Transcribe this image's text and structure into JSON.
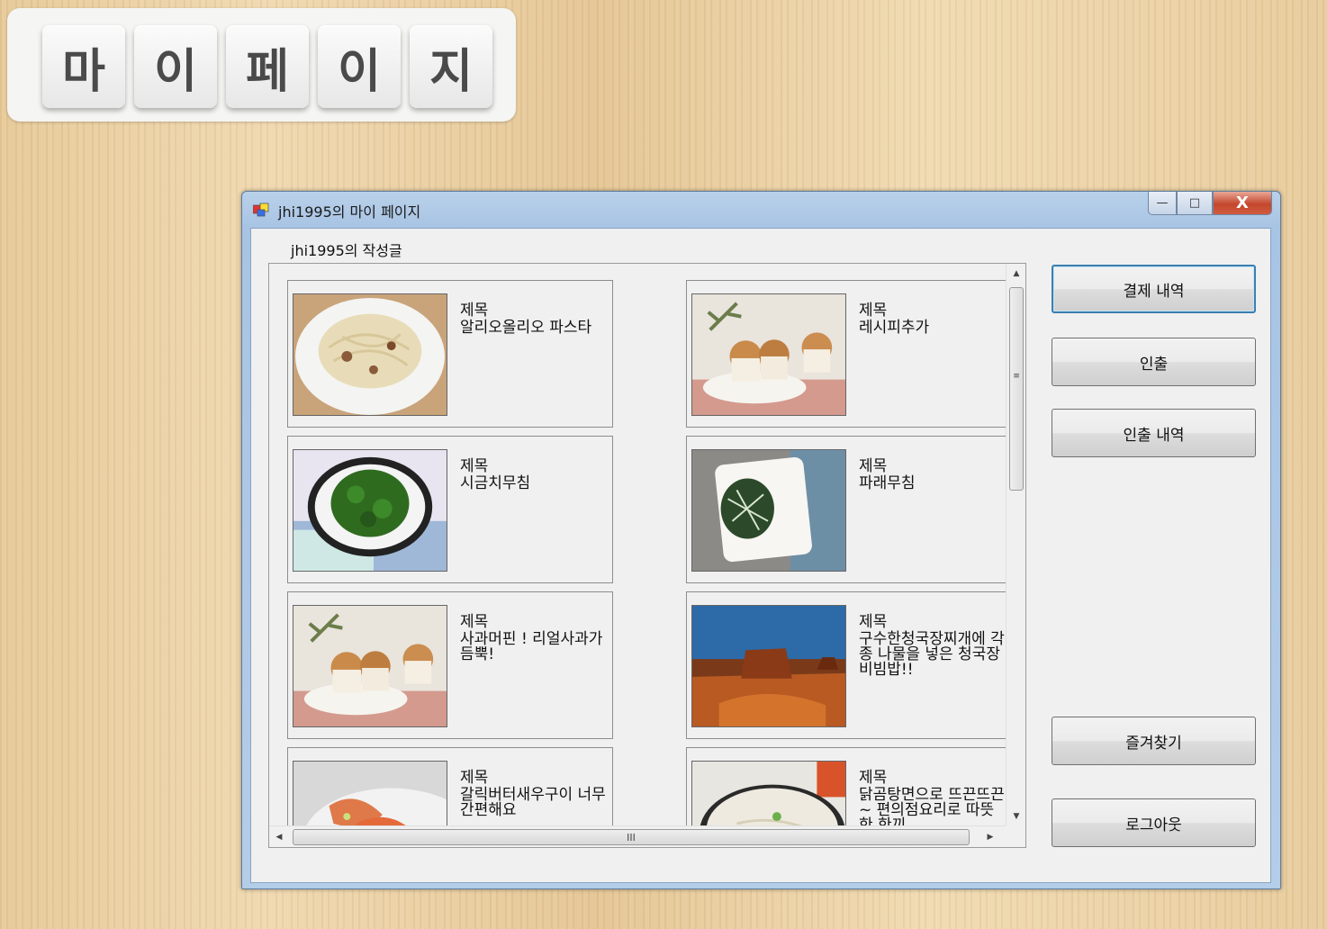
{
  "banner": {
    "chars": [
      "마",
      "이",
      "페",
      "이",
      "지"
    ]
  },
  "window": {
    "title": "jhi1995의 마이 페이지",
    "section_label": "jhi1995의 작성글",
    "controls": {
      "minimize": "—",
      "maximize": "□",
      "close": "X"
    }
  },
  "posts": [
    {
      "label": "제목",
      "title": "알리오올리오 파스타",
      "image": "pasta"
    },
    {
      "label": "제목",
      "title": "레시피추가",
      "image": "muffins"
    },
    {
      "label": "제목",
      "title": "시금치무침",
      "image": "spinach"
    },
    {
      "label": "제목",
      "title": "파래무침",
      "image": "seaweed"
    },
    {
      "label": "제목",
      "title": "사과머핀 ! 리얼사과가 듬뿍!",
      "image": "muffins"
    },
    {
      "label": "제목",
      "title": "구수한청국장찌개에 각종 나물을 넣은 청국장비빔밥!!",
      "image": "desert"
    },
    {
      "label": "제목",
      "title": "갈릭버터새우구이 너무 간편해요",
      "image": "shrimp"
    },
    {
      "label": "제목",
      "title": "닭곰탕면으로 뜨끈뜨끈~ 편의점요리로 따뜻한 한끼",
      "image": "soup"
    }
  ],
  "buttons": {
    "payment_history": "결제 내역",
    "print": "인출",
    "print_history": "인출 내역",
    "favorites": "즐겨찾기",
    "logout": "로그아웃"
  },
  "scroll": {
    "h_thumb_grip": "III",
    "v_thumb_grip": "≡"
  }
}
